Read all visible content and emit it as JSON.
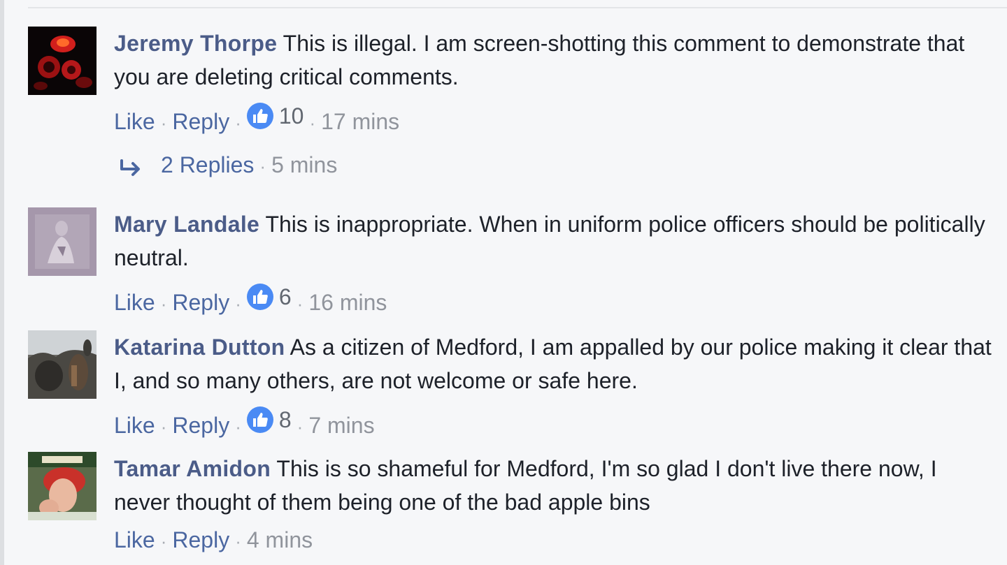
{
  "colors": {
    "author": "#4b5c88",
    "link": "#4b67a1",
    "meta": "#90949c",
    "like_badge": "#4a8af4",
    "background": "#f6f7f9"
  },
  "comments": [
    {
      "author": "Jeremy Thorpe",
      "text": "This is illegal. I am screen-shotting this comment to demonstrate that you are deleting critical comments.",
      "like_label": "Like",
      "reply_label": "Reply",
      "sep": "·",
      "likes": "10",
      "time": "17 mins",
      "avatar_icon": "red-flower-avatar"
    },
    {
      "author": "Mary Landale",
      "text": "This is inappropriate. When in uniform police officers should be politically neutral.",
      "like_label": "Like",
      "reply_label": "Reply",
      "sep": "·",
      "likes": "6",
      "time": "16 mins",
      "avatar_icon": "purple-portrait-avatar"
    },
    {
      "author": "Katarina Dutton",
      "text": "As a citizen of Medford, I am appalled by our police making it clear that I, and so many others, are not welcome or safe here.",
      "like_label": "Like",
      "reply_label": "Reply",
      "sep": "·",
      "likes": "8",
      "time": "7 mins",
      "avatar_icon": "outdoor-photo-avatar"
    },
    {
      "author": "Tamar Amidon",
      "text": "This is so shameful for Medford, I'm so glad I don't live there now, I never thought of them being one of the bad apple bins",
      "like_label": "Like",
      "reply_label": "Reply",
      "sep": "·",
      "time": "4 mins",
      "avatar_icon": "woman-portrait-avatar"
    }
  ],
  "replies_summary": {
    "label": "2 Replies",
    "sep": "·",
    "time": "5 mins"
  }
}
